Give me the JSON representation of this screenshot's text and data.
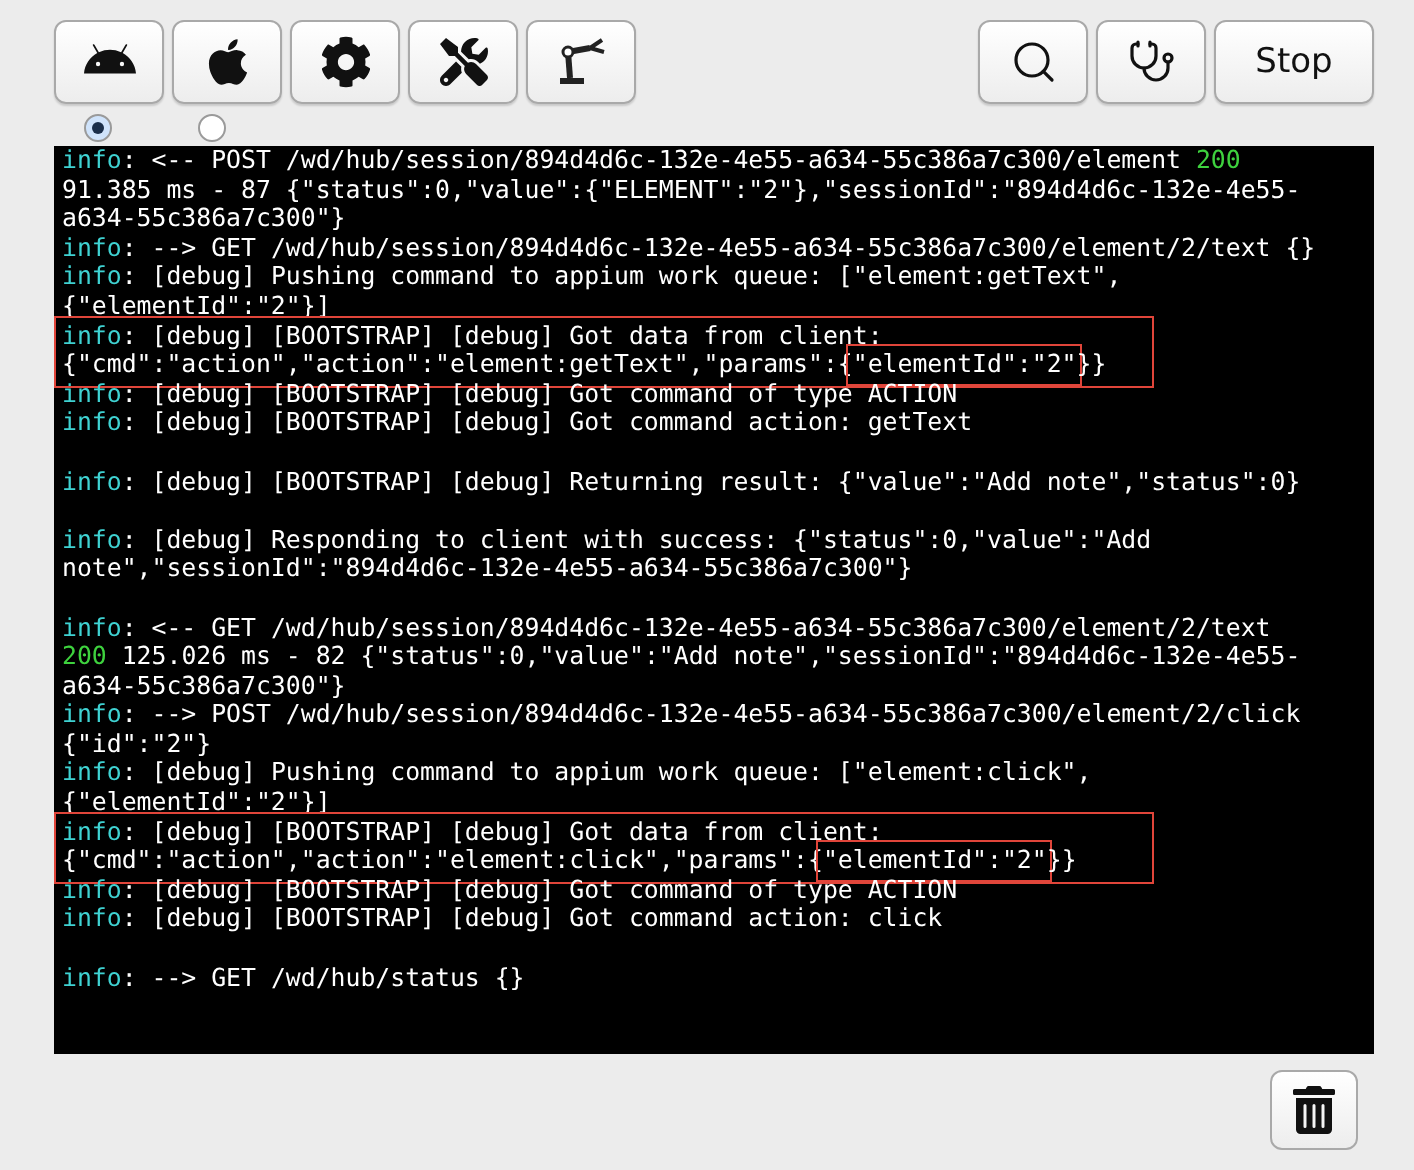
{
  "toolbar": {
    "left_buttons": [
      {
        "kind": "android"
      },
      {
        "kind": "apple"
      },
      {
        "kind": "settings"
      },
      {
        "kind": "tools"
      },
      {
        "kind": "inspector"
      }
    ],
    "right_buttons": [
      {
        "kind": "search"
      },
      {
        "kind": "doctor"
      },
      {
        "kind": "text",
        "label": "Stop"
      }
    ]
  },
  "platforms": [
    {
      "selected": true
    },
    {
      "selected": false
    }
  ],
  "log": [
    {
      "highlighted": false,
      "blank_after": false,
      "lines": [
        [
          {
            "kind": "level",
            "text": "info"
          },
          {
            "kind": "plain",
            "text": ": <-- POST /wd/hub/session/894d4d6c-132e-4e55-a634-55c386a7c300/element "
          },
          {
            "kind": "status",
            "text": "200"
          }
        ],
        [
          {
            "kind": "plain",
            "text": "91.385 ms - 87 {\"status\":0,\"value\":{\"ELEMENT\":\"2\"},\"sessionId\":\"894d4d6c-132e-4e55-"
          }
        ],
        [
          {
            "kind": "plain",
            "text": "a634-55c386a7c300\"}"
          }
        ]
      ]
    },
    {
      "highlighted": false,
      "blank_after": false,
      "lines": [
        [
          {
            "kind": "level",
            "text": "info"
          },
          {
            "kind": "plain",
            "text": ": --> GET /wd/hub/session/894d4d6c-132e-4e55-a634-55c386a7c300/element/2/text {}"
          }
        ]
      ]
    },
    {
      "highlighted": false,
      "blank_after": false,
      "lines": [
        [
          {
            "kind": "level",
            "text": "info"
          },
          {
            "kind": "plain",
            "text": ": [debug] Pushing command to appium work queue: [\"element:getText\","
          }
        ],
        [
          {
            "kind": "plain",
            "text": "{\"elementId\":\"2\"}]"
          }
        ]
      ]
    },
    {
      "highlighted": true,
      "blank_after": false,
      "lines": [
        [
          {
            "kind": "level",
            "text": "info"
          },
          {
            "kind": "plain",
            "text": ": [debug] [BOOTSTRAP] [debug] Got data from client:"
          }
        ],
        [
          {
            "kind": "plain",
            "text": "{\"cmd\":\"action\",\"action\":\"element:getText\",\"params\":{"
          },
          {
            "kind": "marked",
            "text": "\"elementId\":\"2\""
          },
          {
            "kind": "plain",
            "text": "}}"
          }
        ]
      ]
    },
    {
      "highlighted": false,
      "blank_after": false,
      "lines": [
        [
          {
            "kind": "level",
            "text": "info"
          },
          {
            "kind": "plain",
            "text": ": [debug] [BOOTSTRAP] [debug] Got command of type ACTION"
          }
        ]
      ]
    },
    {
      "highlighted": false,
      "blank_after": true,
      "lines": [
        [
          {
            "kind": "level",
            "text": "info"
          },
          {
            "kind": "plain",
            "text": ": [debug] [BOOTSTRAP] [debug] Got command action: getText"
          }
        ]
      ]
    },
    {
      "highlighted": false,
      "blank_after": true,
      "lines": [
        [
          {
            "kind": "level",
            "text": "info"
          },
          {
            "kind": "plain",
            "text": ": [debug] [BOOTSTRAP] [debug] Returning result: {\"value\":\"Add note\",\"status\":0}"
          }
        ]
      ]
    },
    {
      "highlighted": false,
      "blank_after": true,
      "lines": [
        [
          {
            "kind": "level",
            "text": "info"
          },
          {
            "kind": "plain",
            "text": ": [debug] Responding to client with success: {\"status\":0,\"value\":\"Add"
          }
        ],
        [
          {
            "kind": "plain",
            "text": "note\",\"sessionId\":\"894d4d6c-132e-4e55-a634-55c386a7c300\"}"
          }
        ]
      ]
    },
    {
      "highlighted": false,
      "blank_after": false,
      "lines": [
        [
          {
            "kind": "level",
            "text": "info"
          },
          {
            "kind": "plain",
            "text": ": <-- GET /wd/hub/session/894d4d6c-132e-4e55-a634-55c386a7c300/element/2/text"
          }
        ],
        [
          {
            "kind": "status",
            "text": "200"
          },
          {
            "kind": "plain",
            "text": " 125.026 ms - 82 {\"status\":0,\"value\":\"Add note\",\"sessionId\":\"894d4d6c-132e-4e55-"
          }
        ],
        [
          {
            "kind": "plain",
            "text": "a634-55c386a7c300\"}"
          }
        ]
      ]
    },
    {
      "highlighted": false,
      "blank_after": false,
      "lines": [
        [
          {
            "kind": "level",
            "text": "info"
          },
          {
            "kind": "plain",
            "text": ": --> POST /wd/hub/session/894d4d6c-132e-4e55-a634-55c386a7c300/element/2/click"
          }
        ],
        [
          {
            "kind": "plain",
            "text": "{\"id\":\"2\"}"
          }
        ]
      ]
    },
    {
      "highlighted": false,
      "blank_after": false,
      "lines": [
        [
          {
            "kind": "level",
            "text": "info"
          },
          {
            "kind": "plain",
            "text": ": [debug] Pushing command to appium work queue: [\"element:click\","
          }
        ],
        [
          {
            "kind": "plain",
            "text": "{\"elementId\":\"2\"}]"
          }
        ]
      ]
    },
    {
      "highlighted": true,
      "blank_after": false,
      "lines": [
        [
          {
            "kind": "level",
            "text": "info"
          },
          {
            "kind": "plain",
            "text": ": [debug] [BOOTSTRAP] [debug] Got data from client:"
          }
        ],
        [
          {
            "kind": "plain",
            "text": "{\"cmd\":\"action\",\"action\":\"element:click\",\"params\":{"
          },
          {
            "kind": "marked",
            "text": "\"elementId\":\"2\""
          },
          {
            "kind": "plain",
            "text": "}}"
          }
        ]
      ]
    },
    {
      "highlighted": false,
      "blank_after": false,
      "lines": [
        [
          {
            "kind": "level",
            "text": "info"
          },
          {
            "kind": "plain",
            "text": ": [debug] [BOOTSTRAP] [debug] Got command of type ACTION"
          }
        ]
      ]
    },
    {
      "highlighted": false,
      "blank_after": true,
      "lines": [
        [
          {
            "kind": "level",
            "text": "info"
          },
          {
            "kind": "plain",
            "text": ": [debug] [BOOTSTRAP] [debug] Got command action: click"
          }
        ]
      ]
    },
    {
      "highlighted": false,
      "blank_after": false,
      "lines": [
        [
          {
            "kind": "level",
            "text": "info"
          },
          {
            "kind": "plain",
            "text": ": --> GET /wd/hub/status {}"
          }
        ]
      ]
    }
  ],
  "footer": {
    "buttons": [
      {
        "kind": "clear"
      }
    ]
  }
}
